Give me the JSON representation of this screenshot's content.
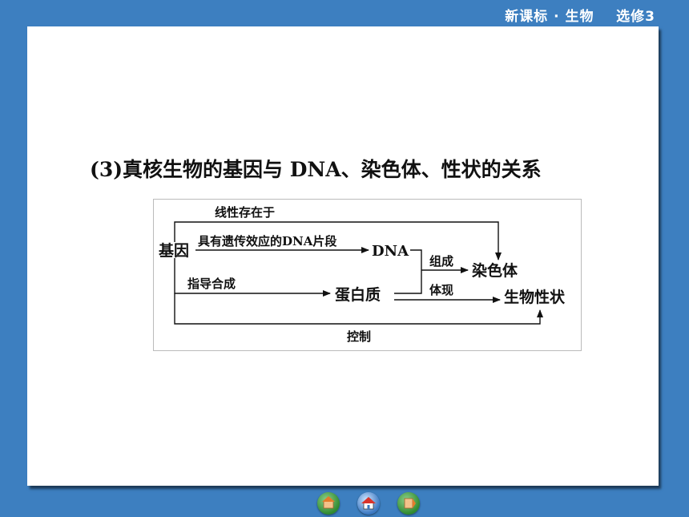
{
  "header": {
    "series_label": "新课标 · 生物    选修3"
  },
  "slide": {
    "heading": "(3)真核生物的基因与 DNA、染色体、性状的关系"
  },
  "diagram": {
    "nodes": {
      "gene": "基因",
      "dna": "DNA",
      "chromosome": "染色体",
      "protein": "蛋白质",
      "trait": "生物性状"
    },
    "edges": {
      "linear_exists_in": "线性存在于",
      "gene_to_dna": "具有遗传效应的DNA片段",
      "compose": "组成",
      "guide_synthesis": "指导合成",
      "embody": "体现",
      "control": "控制"
    }
  },
  "nav": {
    "buttons": [
      "previous",
      "home",
      "next"
    ]
  },
  "colors": {
    "background": "#3d7fc0",
    "slide": "#ffffff",
    "text": "#111111"
  }
}
